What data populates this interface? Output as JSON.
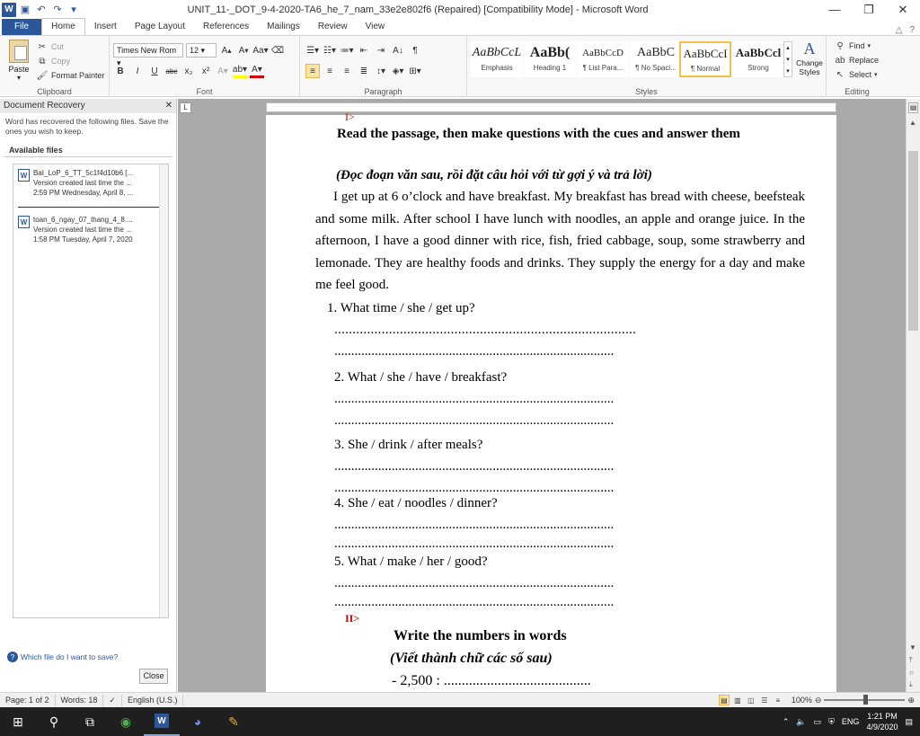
{
  "window": {
    "title": "UNIT_11-_DOT_9-4-2020-TA6_he_7_nam_33e2e802f6 (Repaired) [Compatibility Mode] - Microsoft Word"
  },
  "tabs": [
    "File",
    "Home",
    "Insert",
    "Page Layout",
    "References",
    "Mailings",
    "Review",
    "View"
  ],
  "clipboard": {
    "paste": "Paste",
    "cut": "Cut",
    "copy": "Copy",
    "format_painter": "Format Painter",
    "label": "Clipboard"
  },
  "font": {
    "name": "Times New Rom",
    "size": "12",
    "label": "Font"
  },
  "paragraph": {
    "label": "Paragraph"
  },
  "styles": {
    "items": [
      {
        "preview": "AaBbCcL",
        "name": "Emphasis"
      },
      {
        "preview": "AaBb(",
        "name": "Heading 1"
      },
      {
        "preview": "AaBbCcD",
        "name": "¶ List Para..."
      },
      {
        "preview": "AaBbC",
        "name": "¶ No Spaci..."
      },
      {
        "preview": "AaBbCcI",
        "name": "¶ Normal"
      },
      {
        "preview": "AaBbCcl",
        "name": "Strong"
      }
    ],
    "change": "Change Styles",
    "label": "Styles"
  },
  "editing": {
    "find": "Find",
    "replace": "Replace",
    "select": "Select",
    "label": "Editing"
  },
  "recovery": {
    "title": "Document Recovery",
    "message": "Word has recovered the following files.  Save the ones you wish to keep.",
    "available": "Available files",
    "files": [
      {
        "name": "BaI_LoP_6_TT_5c1f4d10b6  [...",
        "version": "Version created last time the ...",
        "time": "2:59 PM Wednesday, April 8, ..."
      },
      {
        "name": "toan_6_ngay_07_thang_4_8....",
        "version": "Version created last time the ...",
        "time": "1:58 PM Tuesday, April 7, 2020"
      }
    ],
    "which": "Which file do I want to save?",
    "close": "Close"
  },
  "doc": {
    "marker1": "I>",
    "heading1": "Read the passage, then make questions with the cues and answer them",
    "heading1_vi": "(Đọc đoạn văn sau,  rồi đặt câu hỏi với từ gợi ý và trả lời)",
    "passage": "I get up at 6 o’clock and have breakfast. My breakfast has bread with cheese, beefsteak and some milk. After school I have lunch with noodles, an apple and orange juice. In the afternoon, I have a good dinner with rice, fish, fried cabbage, soup, some strawberry and lemonade. They are healthy foods and drinks. They supply the energy for a day and make me feel good.",
    "questions": [
      "1. What time / she / get up?",
      "2.  What / she / have / breakfast?",
      "3.  She / drink / after meals?",
      "4.  She / eat / noodles / dinner?",
      "5.  What / make / her / good?"
    ],
    "dots": "...................................................................................",
    "marker2": "II>",
    "heading2": "Write the numbers in words",
    "heading2_vi": "(Viết thành chữ các số sau)",
    "item1": "-    2,500  : ........................................."
  },
  "status": {
    "page": "Page: 1 of 2",
    "words": "Words: 18",
    "lang": "English (U.S.)",
    "zoom": "100%"
  },
  "tray": {
    "lang": "ENG",
    "time": "1:21 PM",
    "date": "4/9/2020"
  }
}
